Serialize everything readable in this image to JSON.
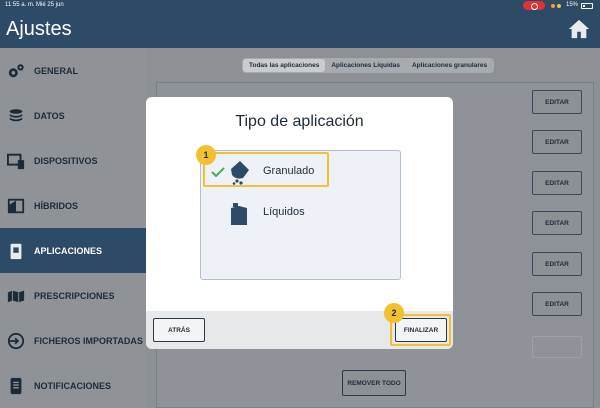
{
  "status_bar": {
    "time": "11:55 a. m.",
    "date": "Mié 25 jun",
    "battery": "15%"
  },
  "header": {
    "title": "Ajustes"
  },
  "sidebar": {
    "items": [
      {
        "label": "GENERAL",
        "icon": "gears-icon"
      },
      {
        "label": "DATOS",
        "icon": "database-icon"
      },
      {
        "label": "DISPOSITIVOS",
        "icon": "devices-icon"
      },
      {
        "label": "HÍBRIDOS",
        "icon": "hybrid-icon"
      },
      {
        "label": "APLICACIONES",
        "icon": "application-icon"
      },
      {
        "label": "PRESCRIPCIONES",
        "icon": "prescription-icon"
      },
      {
        "label": "FICHEROS IMPORTADAS",
        "icon": "import-icon"
      },
      {
        "label": "NOTIFICACIONES",
        "icon": "notification-icon"
      }
    ],
    "active_index": 4
  },
  "main": {
    "tabs": [
      {
        "label": "Todas las aplicaciones",
        "selected": true
      },
      {
        "label": "Aplicaciones Líquidas",
        "selected": false
      },
      {
        "label": "Aplicaciones granulares",
        "selected": false
      }
    ],
    "edit_label": "EDITAR",
    "remove_all_label": "REMOVER TODO"
  },
  "modal": {
    "title": "Tipo de aplicación",
    "options": [
      {
        "label": "Granulado",
        "selected": true
      },
      {
        "label": "Líquidos",
        "selected": false
      }
    ],
    "back_label": "ATRÁS",
    "finish_label": "FINALIZAR"
  },
  "callouts": {
    "first": "1",
    "second": "2"
  },
  "colors": {
    "header": "#2d4a66",
    "highlight": "#f3c12d",
    "check": "#4caf50"
  }
}
